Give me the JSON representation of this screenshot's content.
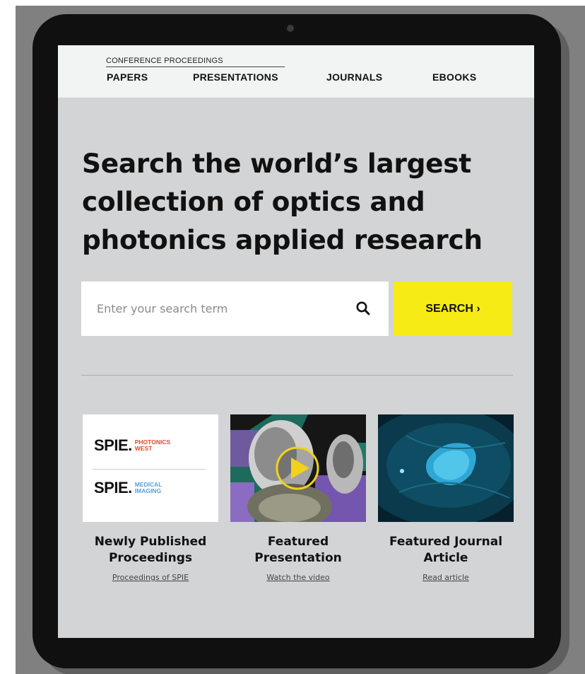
{
  "nav": {
    "conference_label": "CONFERENCE PROCEEDINGS",
    "papers": "PAPERS",
    "presentations": "PRESENTATIONS",
    "journals": "JOURNALS",
    "ebooks": "EBOOKS"
  },
  "hero": {
    "headline_line1": "Search the world’s largest",
    "headline_line2": "collection of optics and",
    "headline_line3": "photonics applied research"
  },
  "search": {
    "placeholder": "Enter your search term",
    "button_label": "SEARCH ›"
  },
  "cards": [
    {
      "title_line1": "Newly Published",
      "title_line2": "Proceedings",
      "link": "Proceedings of SPIE",
      "logos": [
        {
          "brand": "SPIE.",
          "sub_line1": "PHOTONICS",
          "sub_line2": "WEST",
          "color": "#e04a2a"
        },
        {
          "brand": "SPIE.",
          "sub_line1": "MEDICAL",
          "sub_line2": "IMAGING",
          "color": "#5a9fd0"
        }
      ]
    },
    {
      "title_line1": "Featured",
      "title_line2": "Presentation",
      "link": "Watch the video"
    },
    {
      "title_line1": "Featured Journal",
      "title_line2": "Article",
      "link": "Read article"
    }
  ],
  "colors": {
    "accent_yellow": "#f6eb14",
    "screen_bg": "#d3d4d6",
    "nav_bg": "#f2f3f3",
    "device_frame": "#101010"
  }
}
